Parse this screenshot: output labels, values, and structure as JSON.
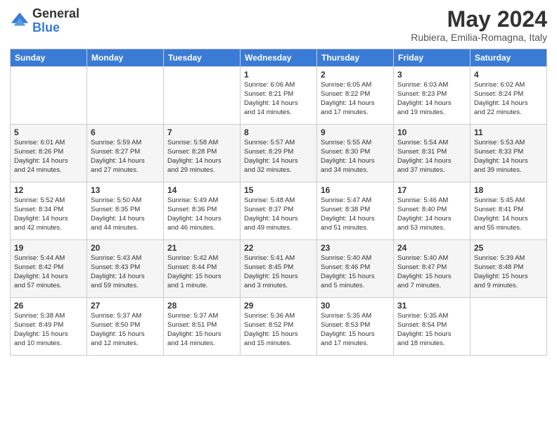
{
  "header": {
    "logo_general": "General",
    "logo_blue": "Blue",
    "month_year": "May 2024",
    "location": "Rubiera, Emilia-Romagna, Italy"
  },
  "days_of_week": [
    "Sunday",
    "Monday",
    "Tuesday",
    "Wednesday",
    "Thursday",
    "Friday",
    "Saturday"
  ],
  "weeks": [
    [
      {
        "day": "",
        "info": ""
      },
      {
        "day": "",
        "info": ""
      },
      {
        "day": "",
        "info": ""
      },
      {
        "day": "1",
        "info": "Sunrise: 6:06 AM\nSunset: 8:21 PM\nDaylight: 14 hours\nand 14 minutes."
      },
      {
        "day": "2",
        "info": "Sunrise: 6:05 AM\nSunset: 8:22 PM\nDaylight: 14 hours\nand 17 minutes."
      },
      {
        "day": "3",
        "info": "Sunrise: 6:03 AM\nSunset: 8:23 PM\nDaylight: 14 hours\nand 19 minutes."
      },
      {
        "day": "4",
        "info": "Sunrise: 6:02 AM\nSunset: 8:24 PM\nDaylight: 14 hours\nand 22 minutes."
      }
    ],
    [
      {
        "day": "5",
        "info": "Sunrise: 6:01 AM\nSunset: 8:26 PM\nDaylight: 14 hours\nand 24 minutes."
      },
      {
        "day": "6",
        "info": "Sunrise: 5:59 AM\nSunset: 8:27 PM\nDaylight: 14 hours\nand 27 minutes."
      },
      {
        "day": "7",
        "info": "Sunrise: 5:58 AM\nSunset: 8:28 PM\nDaylight: 14 hours\nand 29 minutes."
      },
      {
        "day": "8",
        "info": "Sunrise: 5:57 AM\nSunset: 8:29 PM\nDaylight: 14 hours\nand 32 minutes."
      },
      {
        "day": "9",
        "info": "Sunrise: 5:55 AM\nSunset: 8:30 PM\nDaylight: 14 hours\nand 34 minutes."
      },
      {
        "day": "10",
        "info": "Sunrise: 5:54 AM\nSunset: 8:31 PM\nDaylight: 14 hours\nand 37 minutes."
      },
      {
        "day": "11",
        "info": "Sunrise: 5:53 AM\nSunset: 8:33 PM\nDaylight: 14 hours\nand 39 minutes."
      }
    ],
    [
      {
        "day": "12",
        "info": "Sunrise: 5:52 AM\nSunset: 8:34 PM\nDaylight: 14 hours\nand 42 minutes."
      },
      {
        "day": "13",
        "info": "Sunrise: 5:50 AM\nSunset: 8:35 PM\nDaylight: 14 hours\nand 44 minutes."
      },
      {
        "day": "14",
        "info": "Sunrise: 5:49 AM\nSunset: 8:36 PM\nDaylight: 14 hours\nand 46 minutes."
      },
      {
        "day": "15",
        "info": "Sunrise: 5:48 AM\nSunset: 8:37 PM\nDaylight: 14 hours\nand 49 minutes."
      },
      {
        "day": "16",
        "info": "Sunrise: 5:47 AM\nSunset: 8:38 PM\nDaylight: 14 hours\nand 51 minutes."
      },
      {
        "day": "17",
        "info": "Sunrise: 5:46 AM\nSunset: 8:40 PM\nDaylight: 14 hours\nand 53 minutes."
      },
      {
        "day": "18",
        "info": "Sunrise: 5:45 AM\nSunset: 8:41 PM\nDaylight: 14 hours\nand 55 minutes."
      }
    ],
    [
      {
        "day": "19",
        "info": "Sunrise: 5:44 AM\nSunset: 8:42 PM\nDaylight: 14 hours\nand 57 minutes."
      },
      {
        "day": "20",
        "info": "Sunrise: 5:43 AM\nSunset: 8:43 PM\nDaylight: 14 hours\nand 59 minutes."
      },
      {
        "day": "21",
        "info": "Sunrise: 5:42 AM\nSunset: 8:44 PM\nDaylight: 15 hours\nand 1 minute."
      },
      {
        "day": "22",
        "info": "Sunrise: 5:41 AM\nSunset: 8:45 PM\nDaylight: 15 hours\nand 3 minutes."
      },
      {
        "day": "23",
        "info": "Sunrise: 5:40 AM\nSunset: 8:46 PM\nDaylight: 15 hours\nand 5 minutes."
      },
      {
        "day": "24",
        "info": "Sunrise: 5:40 AM\nSunset: 8:47 PM\nDaylight: 15 hours\nand 7 minutes."
      },
      {
        "day": "25",
        "info": "Sunrise: 5:39 AM\nSunset: 8:48 PM\nDaylight: 15 hours\nand 9 minutes."
      }
    ],
    [
      {
        "day": "26",
        "info": "Sunrise: 5:38 AM\nSunset: 8:49 PM\nDaylight: 15 hours\nand 10 minutes."
      },
      {
        "day": "27",
        "info": "Sunrise: 5:37 AM\nSunset: 8:50 PM\nDaylight: 15 hours\nand 12 minutes."
      },
      {
        "day": "28",
        "info": "Sunrise: 5:37 AM\nSunset: 8:51 PM\nDaylight: 15 hours\nand 14 minutes."
      },
      {
        "day": "29",
        "info": "Sunrise: 5:36 AM\nSunset: 8:52 PM\nDaylight: 15 hours\nand 15 minutes."
      },
      {
        "day": "30",
        "info": "Sunrise: 5:35 AM\nSunset: 8:53 PM\nDaylight: 15 hours\nand 17 minutes."
      },
      {
        "day": "31",
        "info": "Sunrise: 5:35 AM\nSunset: 8:54 PM\nDaylight: 15 hours\nand 18 minutes."
      },
      {
        "day": "",
        "info": ""
      }
    ]
  ]
}
